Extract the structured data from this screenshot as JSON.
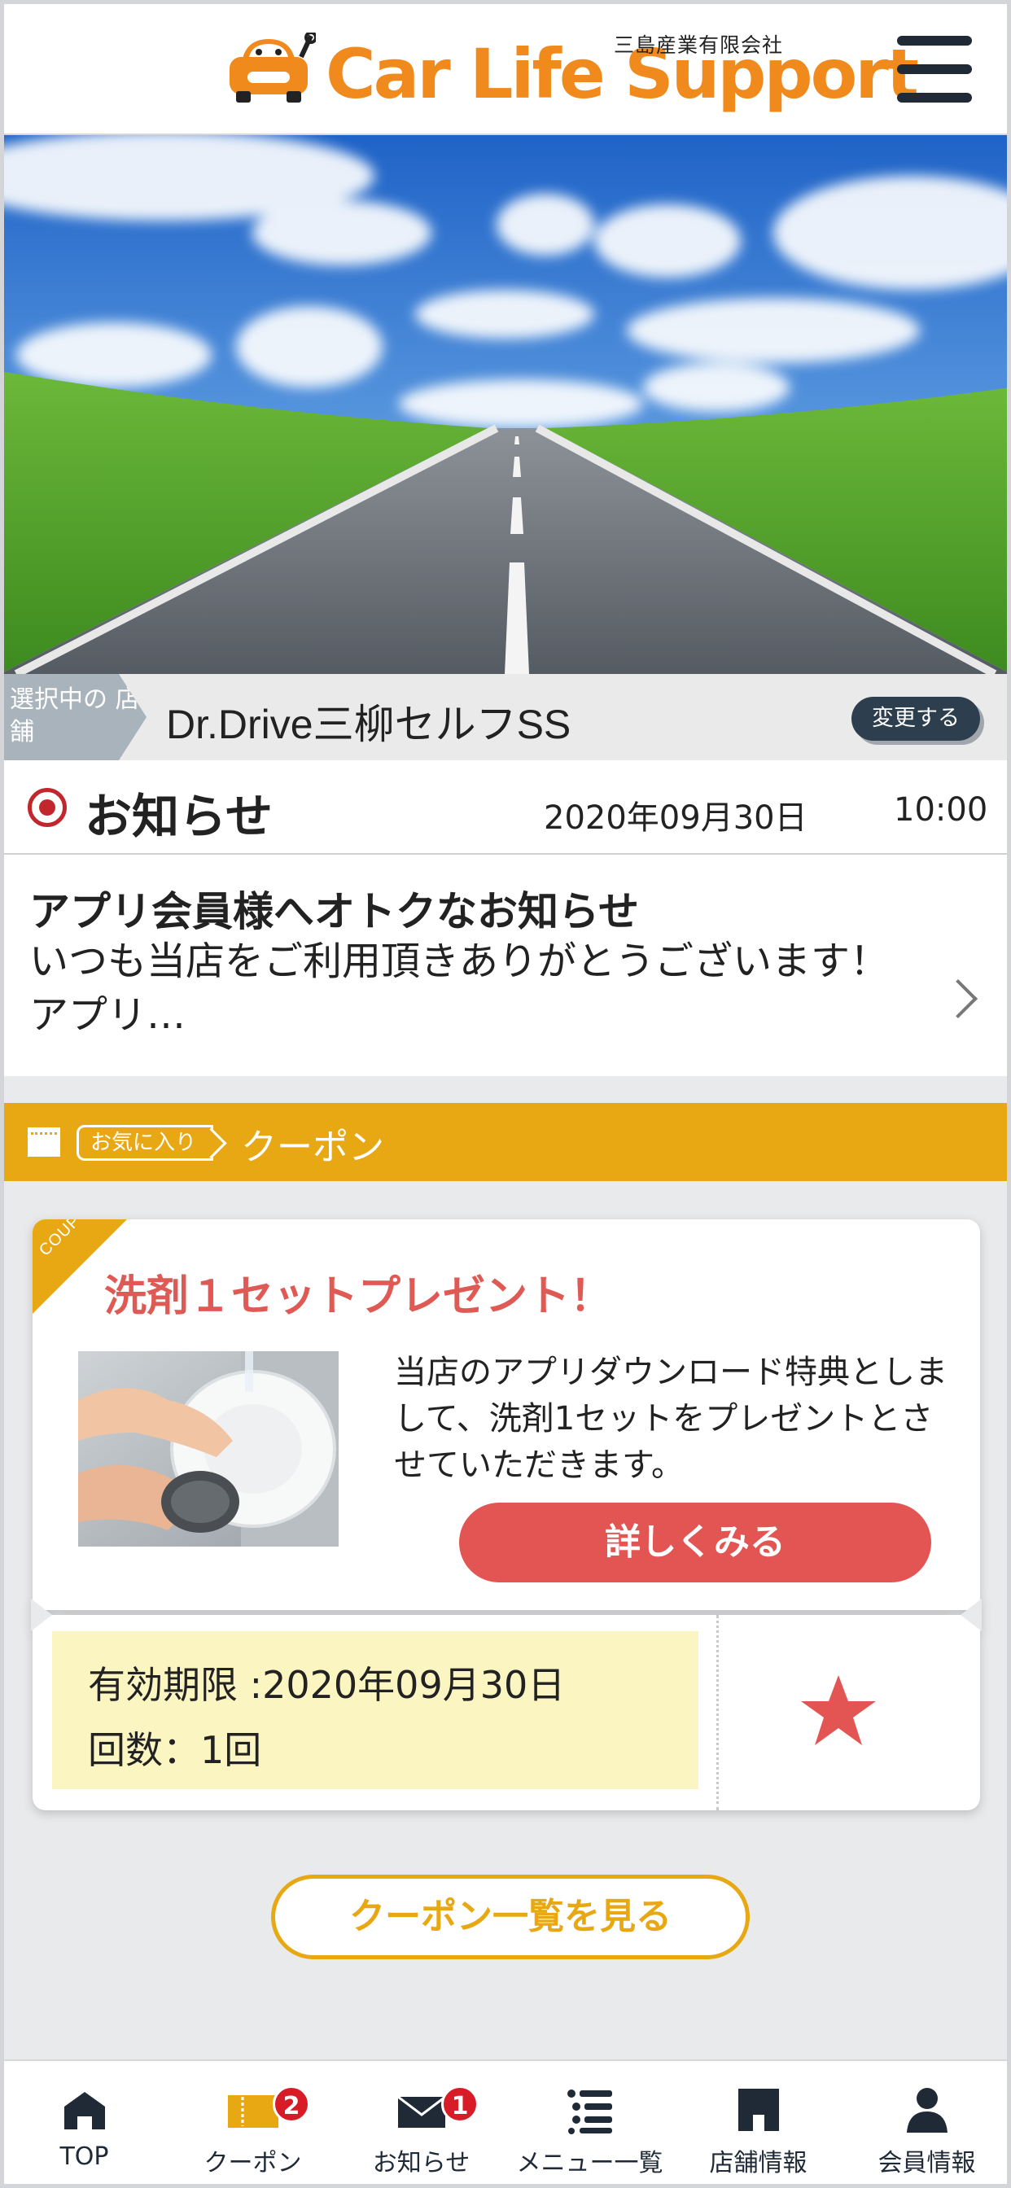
{
  "header": {
    "logo_text": "Car Life Support",
    "company": "三島産業有限会社",
    "menu_icon": "hamburger-menu-icon"
  },
  "store": {
    "tag_label": "選択中の 店舗",
    "name": "Dr.Drive三柳セルフSS",
    "change_label": "変更する"
  },
  "news": {
    "heading": "お知らせ",
    "date": "2020年09月30日",
    "time": "10:00",
    "item_title": "アプリ会員様へオトクなお知らせ",
    "item_body": "いつも当店をご利用頂きありがとうございます！アプリ…"
  },
  "coupon_section": {
    "favorite_tag": "お気に入り",
    "title": "クーポン"
  },
  "coupon": {
    "corner_label": "COUPON",
    "title": "洗剤１セットプレゼント！",
    "description": "当店のアプリダウンロード特典としまして、洗剤1セットをプレゼントとさせていただきます。",
    "detail_button": "詳しくみる",
    "validity": "有効期限 :2020年09月30日",
    "count": "回数：1回"
  },
  "list_button": "クーポン一覧を見る",
  "bottom_nav": [
    {
      "label": "TOP",
      "icon": "home-icon"
    },
    {
      "label": "クーポン",
      "icon": "coupon-icon",
      "badge": "2"
    },
    {
      "label": "お知らせ",
      "icon": "mail-icon",
      "badge": "1"
    },
    {
      "label": "メニュー一覧",
      "icon": "list-icon"
    },
    {
      "label": "店舗情報",
      "icon": "store-icon"
    },
    {
      "label": "会員情報",
      "icon": "user-icon"
    }
  ],
  "colors": {
    "brand_orange": "#f08a1c",
    "coupon_yellow": "#e8a814",
    "accent_red": "#e25553",
    "navy": "#1f2a36"
  }
}
